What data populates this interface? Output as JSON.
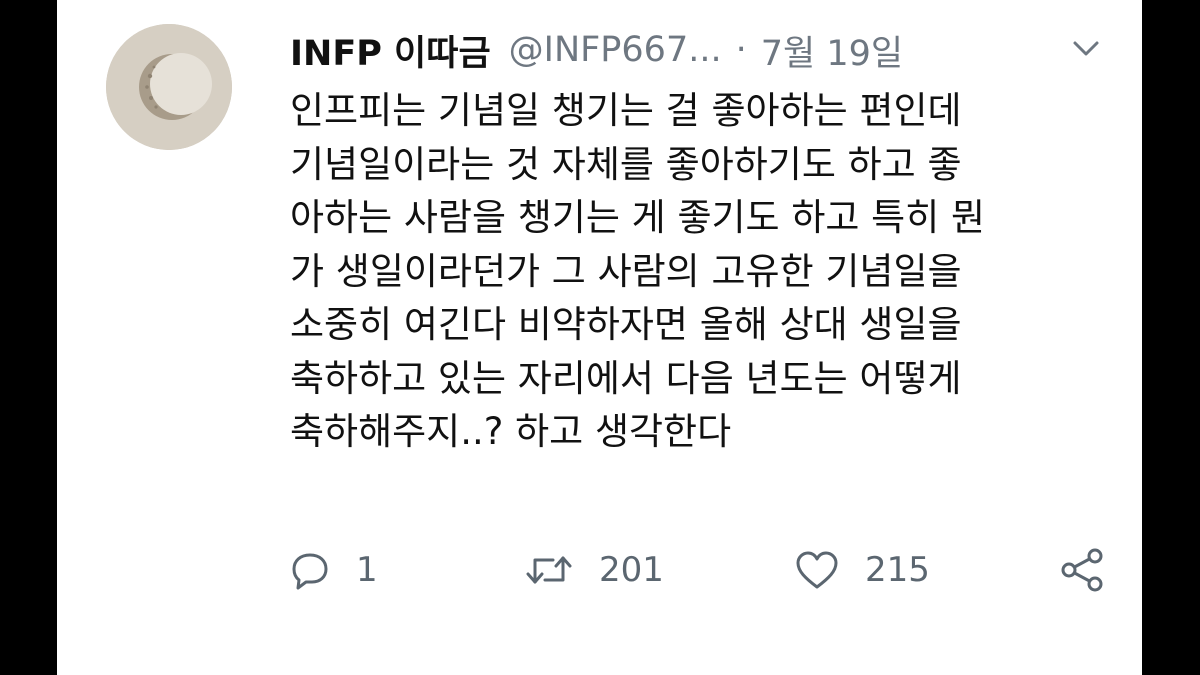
{
  "tweet": {
    "display_name": "INFP 이따금",
    "handle": "@INFP667...",
    "separator": "·",
    "date": "7월 19일",
    "text_lines": [
      "인프피는 기념일 챙기는 걸 좋아하는 편인데",
      "기념일이라는 것 자체를 좋아하기도 하고 좋",
      "아하는 사람을 챙기는 게 좋기도 하고 특히 뭔",
      "가 생일이라던가 그 사람의 고유한 기념일을",
      "소중히 여긴다 비약하자면 올해 상대 생일을",
      "축하하고 있는 자리에서 다음 년도는 어떻게",
      "축하해주지..? 하고 생각한다"
    ]
  },
  "actions": {
    "reply": {
      "icon": "reply-icon",
      "count": "1"
    },
    "retweet": {
      "icon": "retweet-icon",
      "count": "201"
    },
    "like": {
      "icon": "heart-icon",
      "count": "215"
    },
    "share": {
      "icon": "share-icon"
    }
  },
  "colors": {
    "background": "#ffffff",
    "letterbox": "#000000",
    "text": "#111111",
    "muted": "#6e7781",
    "icon": "#5b6670"
  }
}
